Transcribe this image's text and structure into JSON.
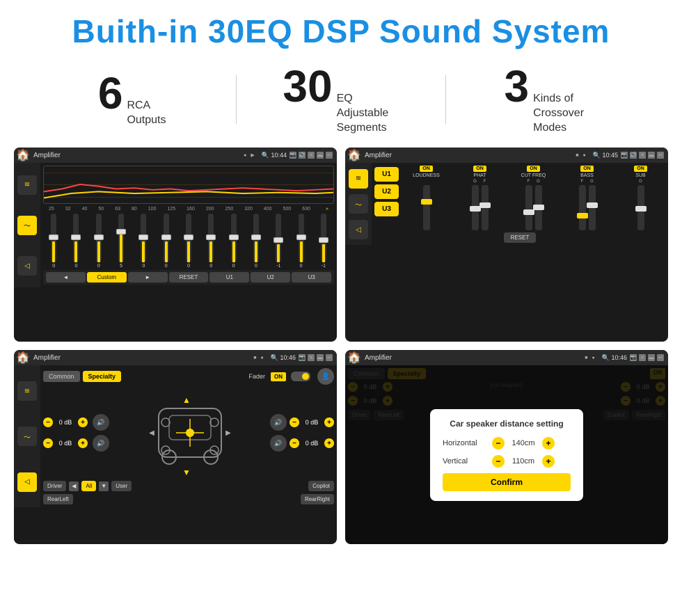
{
  "header": {
    "title": "Buith-in 30EQ DSP Sound System"
  },
  "stats": [
    {
      "number": "6",
      "text": "RCA\nOutputs"
    },
    {
      "number": "30",
      "text": "EQ Adjustable\nSegments"
    },
    {
      "number": "3",
      "text": "Kinds of\nCrossover Modes"
    }
  ],
  "screens": {
    "eq": {
      "status_title": "Amplifier",
      "time": "10:44",
      "freq_labels": [
        "25",
        "32",
        "40",
        "50",
        "63",
        "80",
        "100",
        "125",
        "160",
        "200",
        "250",
        "320",
        "400",
        "500",
        "630"
      ],
      "slider_vals": [
        "0",
        "0",
        "0",
        "5",
        "0",
        "0",
        "0",
        "0",
        "0",
        "0",
        "-1",
        "0",
        "-1"
      ],
      "nav_buttons": [
        "◄",
        "Custom",
        "►",
        "RESET",
        "U1",
        "U2",
        "U3"
      ]
    },
    "amp": {
      "status_title": "Amplifier",
      "time": "10:45",
      "presets": [
        "U1",
        "U2",
        "U3"
      ],
      "channels": [
        "LOUDNESS",
        "PHAT",
        "CUT FREQ",
        "BASS",
        "SUB"
      ],
      "reset_label": "RESET"
    },
    "fader": {
      "status_title": "Amplifier",
      "time": "10:46",
      "tabs": [
        "Common",
        "Specialty"
      ],
      "fader_label": "Fader",
      "on_label": "ON",
      "db_values": [
        "0 dB",
        "0 dB",
        "0 dB",
        "0 dB"
      ],
      "buttons": [
        "Driver",
        "All",
        "User",
        "RearLeft",
        "Copilot",
        "RearRight"
      ]
    },
    "dialog": {
      "status_title": "Amplifier",
      "time": "10:46",
      "tabs": [
        "Common",
        "Specialty"
      ],
      "on_label": "ON",
      "dialog_title": "Car speaker distance setting",
      "horizontal_label": "Horizontal",
      "horizontal_value": "140cm",
      "vertical_label": "Vertical",
      "vertical_value": "110cm",
      "confirm_label": "Confirm",
      "db_values": [
        "0 dB",
        "0 dB"
      ],
      "buttons": [
        "Driver",
        "RearLeft",
        "Copilot",
        "RearRight"
      ]
    }
  }
}
